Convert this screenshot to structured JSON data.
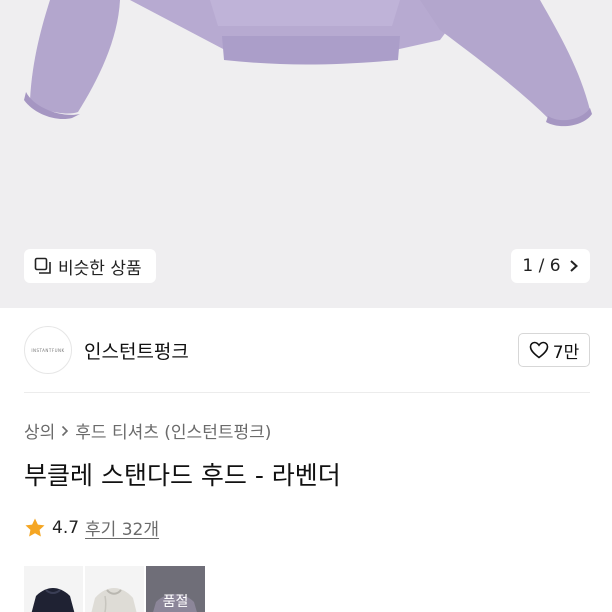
{
  "gallery": {
    "similar_label": "비슷한 상품",
    "counter": "1 / 6",
    "icons": {
      "similar": "stacked-squares-icon",
      "next": "chevron-right-icon"
    }
  },
  "brand": {
    "name": "인스턴트펑크",
    "logo_text": "INSTANTFUNK",
    "likes": "7만"
  },
  "breadcrumb": {
    "category": "상의",
    "subcategory": "후드 티셔츠 (인스턴트펑크)"
  },
  "product": {
    "title": "부클레 스탠다드 후드 - 라벤더",
    "rating": "4.7",
    "reviews": "후기 32개"
  },
  "options": [
    {
      "color": "navy"
    },
    {
      "color": "light-gray"
    },
    {
      "color": "lavender",
      "status": "품절"
    }
  ],
  "colors": {
    "garment": "#b5a8cf",
    "star": "#f5a623"
  }
}
